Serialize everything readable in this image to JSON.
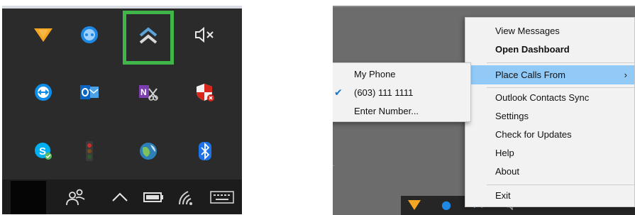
{
  "tray": {
    "icons": [
      {
        "name": "w-app-icon",
        "color": "#f5a623"
      },
      {
        "name": "messenger-icon",
        "color": "#1e88e5"
      },
      {
        "name": "dashboard-chevron-icon",
        "color": "#4a90c8",
        "highlighted": true
      },
      {
        "name": "speaker-muted-icon",
        "color": "#e0e0e0"
      },
      {
        "name": "teamviewer-icon",
        "color": "#0e8ee9"
      },
      {
        "name": "outlook-icon",
        "color": "#0072c6"
      },
      {
        "name": "onenote-icon",
        "color": "#7b3fb0"
      },
      {
        "name": "security-shield-icon",
        "color": "#d9261c"
      },
      {
        "name": "skype-icon",
        "color": "#00aff0"
      },
      {
        "name": "traffic-light-icon",
        "color": "#cc2b2b"
      },
      {
        "name": "globe-icon",
        "color": "#3aa7d8"
      },
      {
        "name": "bluetooth-icon",
        "color": "#1e73e8"
      }
    ],
    "taskbar": [
      {
        "name": "people-icon"
      },
      {
        "name": "show-hidden-icons-chevron-icon"
      },
      {
        "name": "battery-icon"
      },
      {
        "name": "wifi-icon"
      },
      {
        "name": "keyboard-icon"
      }
    ],
    "highlight_color": "#3fb54a"
  },
  "menu": {
    "items": [
      {
        "label": "View Messages",
        "bold": false
      },
      {
        "label": "Open Dashboard",
        "bold": true
      },
      {
        "label": "Place Calls From",
        "bold": false,
        "submenu": true,
        "hover": true
      },
      {
        "label": "Outlook Contacts Sync",
        "bold": false
      },
      {
        "label": "Settings",
        "bold": false
      },
      {
        "label": "Check for Updates",
        "bold": false
      },
      {
        "label": "Help",
        "bold": false
      },
      {
        "label": "About",
        "bold": false
      },
      {
        "label": "Exit",
        "bold": false
      }
    ],
    "submenu_arrow": "›",
    "hover_color": "#91c9f7"
  },
  "submenu": {
    "items": [
      {
        "label": "My Phone",
        "checked": false
      },
      {
        "label": "(603) 111 1111",
        "checked": true
      },
      {
        "label": "Enter Number...",
        "checked": false
      }
    ],
    "check_glyph": "✔"
  }
}
